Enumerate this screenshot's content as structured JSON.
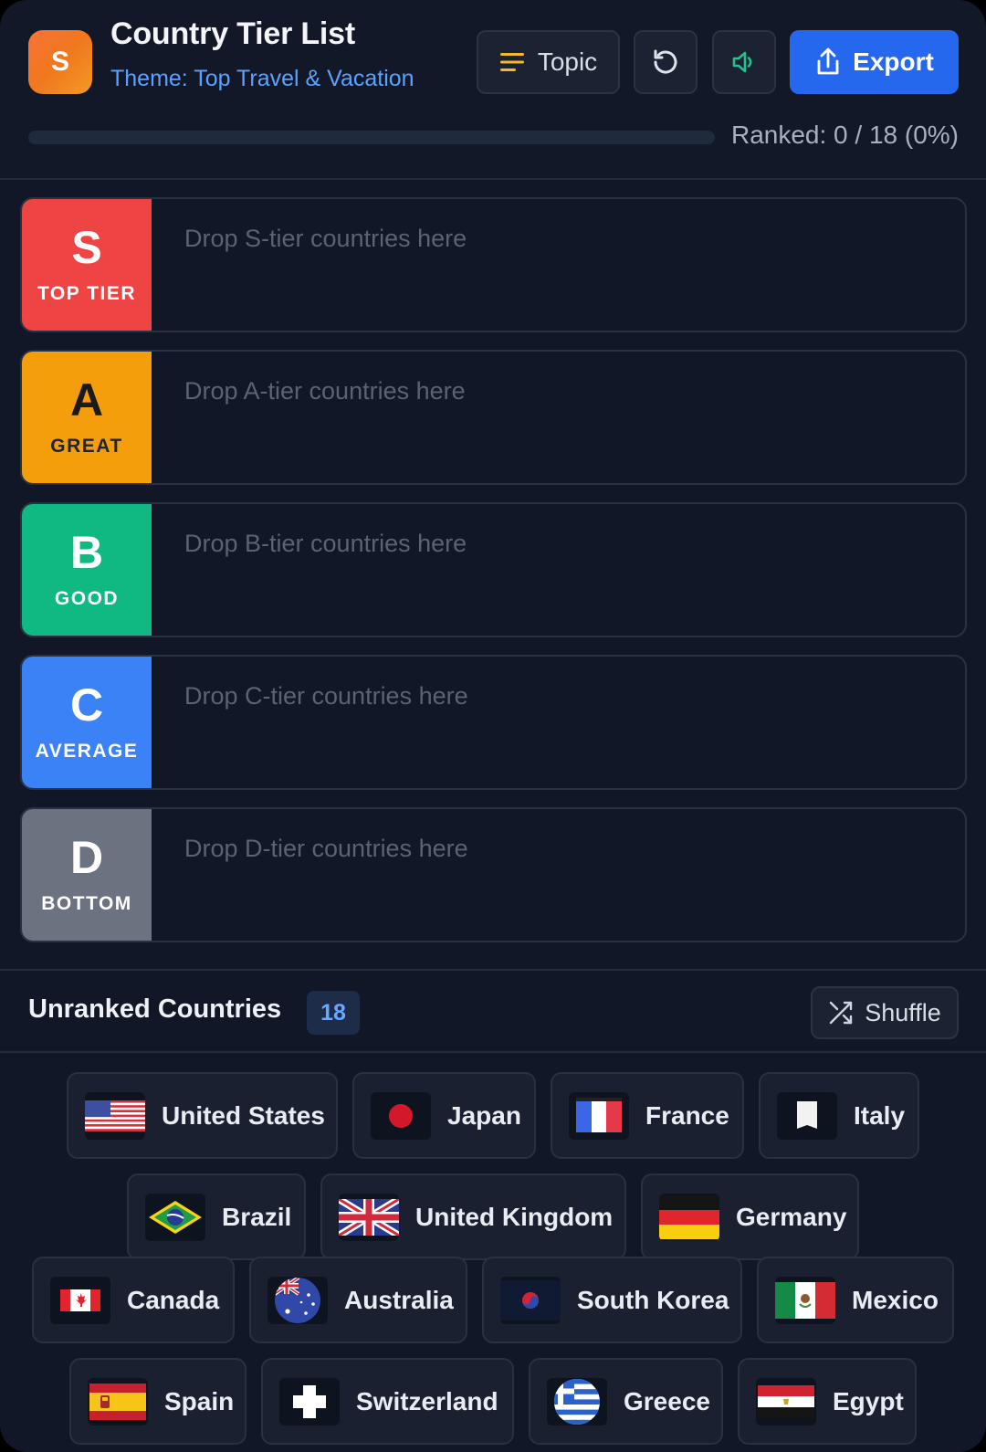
{
  "header": {
    "logo_letter": "S",
    "title": "Country Tier List",
    "subtitle": "Theme: Top Travel & Vacation",
    "topic_label": "Topic",
    "export_label": "Export",
    "ranked_text": "Ranked: 0 / 18 (0%)",
    "progress_fraction": 0
  },
  "tiers": [
    {
      "letter": "S",
      "name": "TOP TIER",
      "placeholder": "Drop S-tier countries here",
      "color": "#ef4444"
    },
    {
      "letter": "A",
      "name": "GREAT",
      "placeholder": "Drop A-tier countries here",
      "color": "#f59e0b"
    },
    {
      "letter": "B",
      "name": "GOOD",
      "placeholder": "Drop B-tier countries here",
      "color": "#10b981"
    },
    {
      "letter": "C",
      "name": "AVERAGE",
      "placeholder": "Drop C-tier countries here",
      "color": "#3b82f6"
    },
    {
      "letter": "D",
      "name": "BOTTOM",
      "placeholder": "Drop D-tier countries here",
      "color": "#6b7280"
    }
  ],
  "unranked": {
    "title": "Unranked Countries",
    "count": "18",
    "shuffle_label": "Shuffle",
    "countries": [
      {
        "name": "United States",
        "flag": "us-flag-icon"
      },
      {
        "name": "Japan",
        "flag": "japan-flag-icon"
      },
      {
        "name": "France",
        "flag": "france-flag-icon"
      },
      {
        "name": "Italy",
        "flag": "italy-flag-icon"
      },
      {
        "name": "Brazil",
        "flag": "brazil-flag-icon"
      },
      {
        "name": "United Kingdom",
        "flag": "uk-flag-icon"
      },
      {
        "name": "Germany",
        "flag": "germany-flag-icon"
      },
      {
        "name": "Canada",
        "flag": "canada-flag-icon"
      },
      {
        "name": "Australia",
        "flag": "australia-flag-icon"
      },
      {
        "name": "South Korea",
        "flag": "south-korea-flag-icon"
      },
      {
        "name": "Mexico",
        "flag": "mexico-flag-icon"
      },
      {
        "name": "Spain",
        "flag": "spain-flag-icon"
      },
      {
        "name": "Switzerland",
        "flag": "switzerland-flag-icon"
      },
      {
        "name": "Greece",
        "flag": "greece-flag-icon"
      },
      {
        "name": "Egypt",
        "flag": "egypt-flag-icon"
      }
    ]
  },
  "colors": {
    "accent": "#2568ee",
    "subtitle": "#5aa2ff",
    "background": "#111726"
  }
}
